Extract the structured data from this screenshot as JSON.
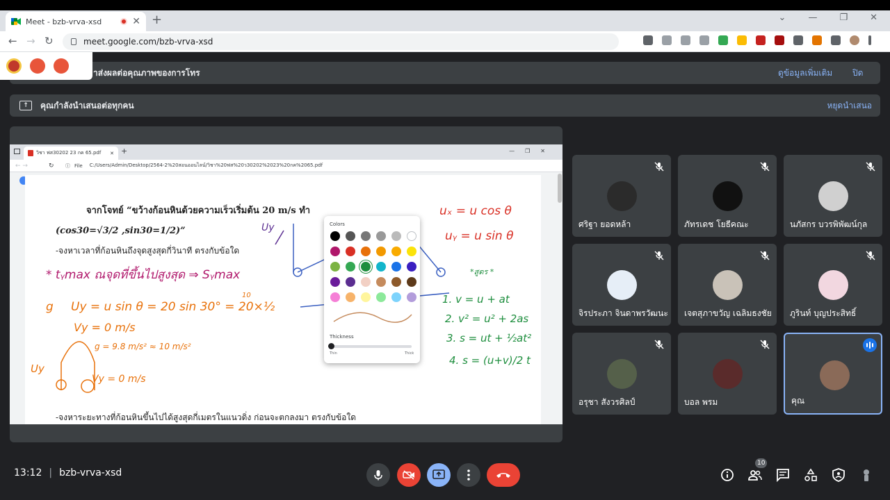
{
  "browser": {
    "tab_title": "Meet - bzb-vrva-xsd",
    "url": "meet.google.com/bzb-vrva-xsd"
  },
  "banners": {
    "quality_msg": "าส่งผลต่อคุณภาพของการโทร",
    "quality_more": "ดูข้อมูลเพิ่มเติม",
    "quality_close": "ปิด",
    "presenting_msg": "คุณกำลังนำเสนอต่อทุกคน",
    "stop_presenting": "หยุดนำเสนอ"
  },
  "shared_screen": {
    "tab_title": "วิชา ฟส30202 23 กค 65.pdf",
    "address_prefix": "File",
    "address": "C:/Users/Admin/Desktop/2564-2%20สอนออนไลน์/วิชา%20ฟส%20ว30202%2023%20กค%2065.pdf",
    "doc_line1": "จากโจทย์  “ขว้างก้อนหินด้วยความเร็วเริ่มต้น 20 m/s ทำ",
    "doc_line2": "(cos30=√3/2 ,sin30=1/2)”",
    "doc_line3": "-จงหาเวลาที่ก้อนหินถึงจุดสูงสุดกี่วินาที ตรงกับข้อใด",
    "doc_line4": "-จงหาระยะทางที่ก้อนหินขึ้นไปได้สูงสุดกี่เมตรในแนวดิ่ง ก่อนจะตกลงมา ตรงกับข้อใด",
    "palette_title": "Colors",
    "thickness_label": "Thickness",
    "thin_label": "Thin",
    "thick_label": "Thick",
    "swatch_colors": [
      "#000000",
      "#555555",
      "#777777",
      "#999999",
      "#bbbbbb",
      "#ffffff",
      "#b0176b",
      "#d93025",
      "#e8710a",
      "#f29900",
      "#f9ab00",
      "#fbe30a",
      "#7cb342",
      "#34a853",
      "#1e8e3e",
      "#12b5cb",
      "#1a73e8",
      "#3a1fc1",
      "#6a1b9a",
      "#5b2e91",
      "#f2d0c4",
      "#c58b5d",
      "#8d5a2b",
      "#5d3a1a",
      "#f57fd6",
      "#f7b36a",
      "#fff59d",
      "#8ce99a",
      "#7dd3fc",
      "#b39ddb"
    ],
    "annotations": {
      "ux": "uₓ = u cos θ",
      "uy": "uᵧ = u sin θ",
      "formula_title": "*สูตร *",
      "f1": "1.  v = u + at",
      "f2": "2.  v² = u² + 2as",
      "f3": "3.  s = ut + ½at²",
      "f4": "4.  s = (u+v)/2 t",
      "star_line": "*  tᵧmax   ณจุดที่ขึ้นไปสูงสุด ⇒ Sᵧmax",
      "ans1": "Uy = u sin θ = 20 sin 30° = 20×½",
      "ten": "10",
      "vy0": "Vy = 0 m/s",
      "g": "g = 9.8 m/s² ≈ 10 m/s²",
      "uy_left": "Uy",
      "vy_bottom": "Vy = 0 m/s",
      "uy_vec": "Uy",
      "letter_g": "g"
    }
  },
  "participants": [
    {
      "name": "ศริฐา ยอดหล้า",
      "muted": true
    },
    {
      "name": "ภัทรเดช โยธีคณะ",
      "muted": true
    },
    {
      "name": "นภัสกร บวรพิพัฒน์กุล",
      "muted": true
    },
    {
      "name": "จิรประภา จินดาพรวัฒนะ",
      "muted": true
    },
    {
      "name": "เจตสุภาขวัญ เฉลิมธงชัย",
      "muted": true
    },
    {
      "name": "ภูรินท์ บุญประสิทธิ์",
      "muted": true
    },
    {
      "name": "อรุชา สังวรศิลป์",
      "muted": true
    },
    {
      "name": "บอล พรม",
      "muted": true
    },
    {
      "name": "คุณ",
      "muted": false
    }
  ],
  "bottombar": {
    "time": "13:12",
    "meeting_code": "bzb-vrva-xsd",
    "participant_count": "10"
  },
  "colors": {
    "meet_bg": "#202124",
    "tile_bg": "#3c4043",
    "accent": "#8ab4f8",
    "danger": "#ea4335"
  }
}
